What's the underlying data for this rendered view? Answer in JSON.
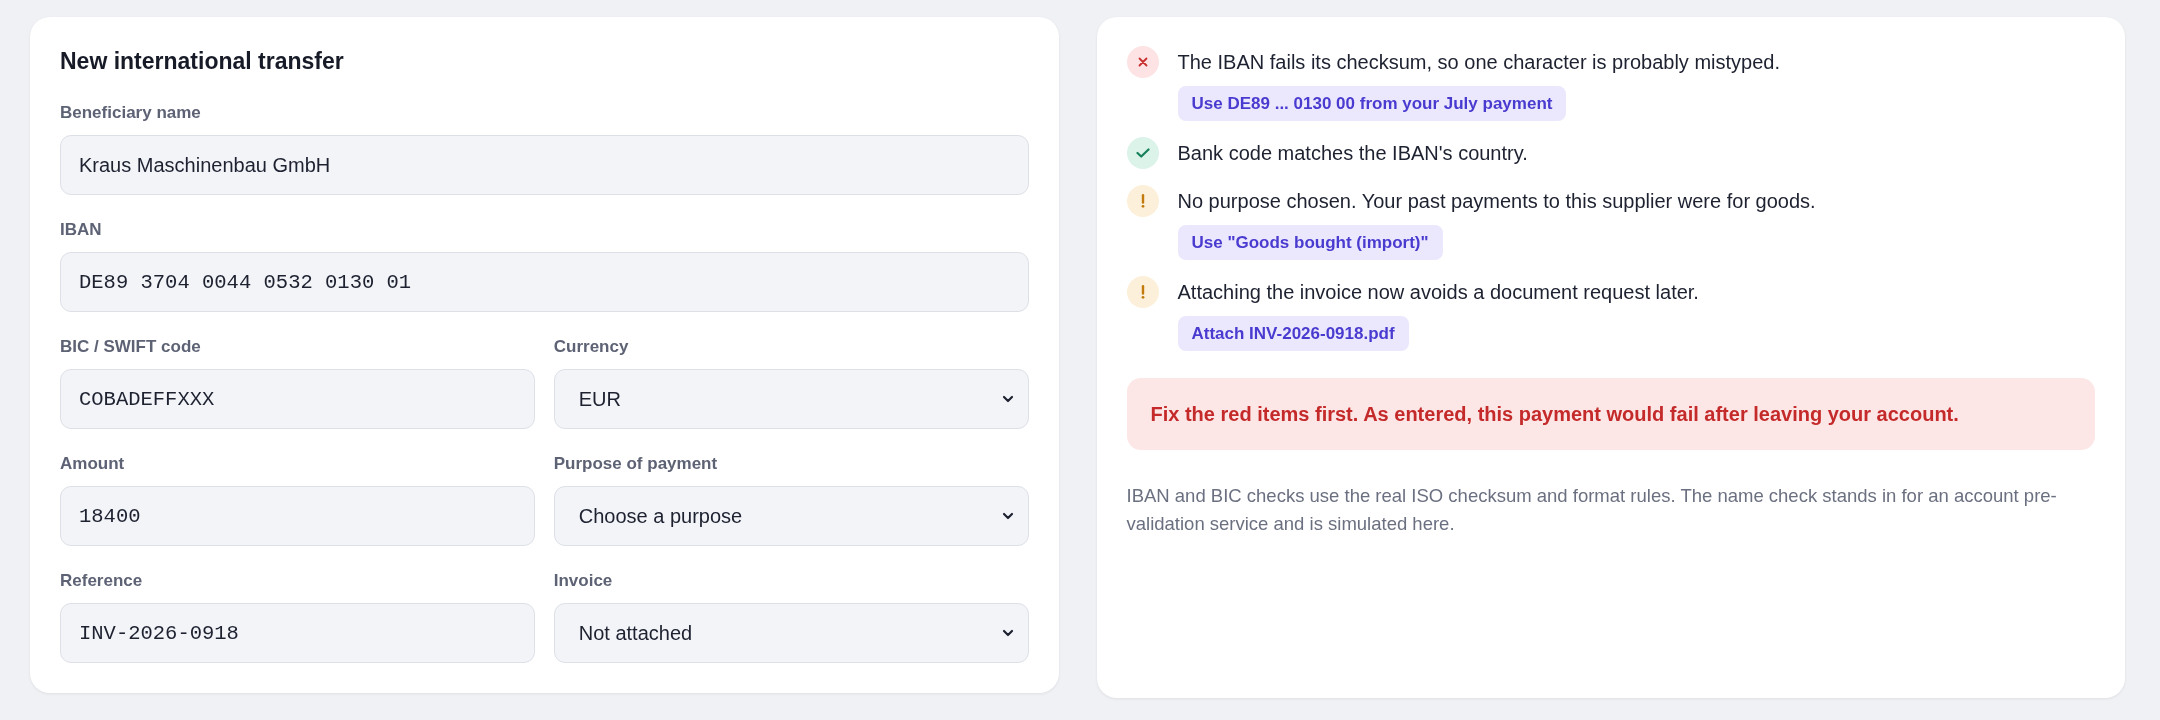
{
  "transfer_form": {
    "title": "New international transfer",
    "rows": [
      {
        "fields": [
          {
            "label": "Beneficiary name",
            "kind": "text",
            "value": "Kraus Maschinenbau GmbH"
          }
        ]
      },
      {
        "fields": [
          {
            "label": "IBAN",
            "kind": "code",
            "value": "DE89 3704 0044 0532 0130 01"
          }
        ]
      },
      {
        "fields": [
          {
            "label": "BIC / SWIFT code",
            "kind": "code",
            "value": "COBADEFFXXX"
          },
          {
            "label": "Currency",
            "kind": "select",
            "value": "EUR"
          }
        ]
      },
      {
        "fields": [
          {
            "label": "Amount",
            "kind": "code",
            "value": "18400"
          },
          {
            "label": "Purpose of payment",
            "kind": "select",
            "value": "Choose a purpose"
          }
        ]
      },
      {
        "fields": [
          {
            "label": "Reference",
            "kind": "code",
            "value": "INV-2026-0918"
          },
          {
            "label": "Invoice",
            "kind": "select",
            "value": "Not attached"
          }
        ]
      }
    ]
  },
  "checks": {
    "items": [
      {
        "kind": "error",
        "message": "The IBAN fails its checksum, so one character is probably mistyped.",
        "suggestion": "Use DE89 ... 0130 00 from your July payment"
      },
      {
        "kind": "ok",
        "message": "Bank code matches the IBAN's country."
      },
      {
        "kind": "warning",
        "message": "No purpose chosen. Your past payments to this supplier were for goods.",
        "suggestion": "Use \"Goods bought (import)\""
      },
      {
        "kind": "warning",
        "message": "Attaching the invoice now avoids a document request later.",
        "suggestion": "Attach INV-2026-0918.pdf"
      }
    ],
    "alert": "Fix the red items first. As entered, this payment would fail after leaving your account.",
    "note": "IBAN and BIC checks use the real ISO checksum and format rules. The name check stands in for an account pre-validation service and is simulated here."
  }
}
